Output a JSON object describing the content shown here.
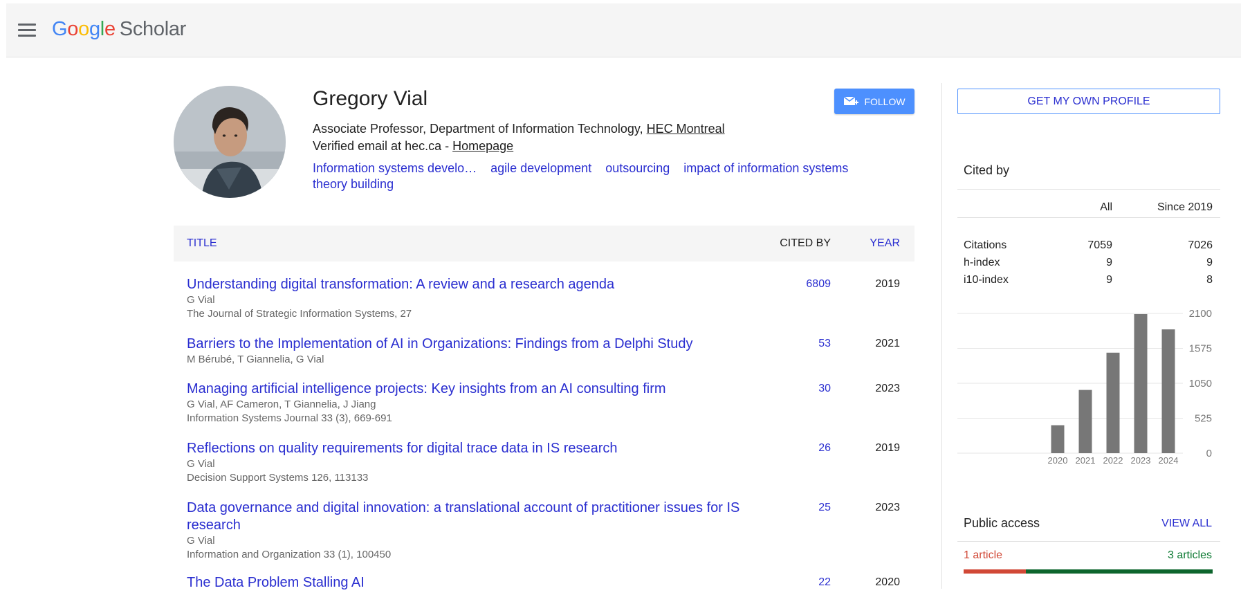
{
  "header": {
    "logo_letters": [
      "G",
      "o",
      "o",
      "g",
      "l",
      "e"
    ],
    "logo_product": "Scholar"
  },
  "profile": {
    "name": "Gregory Vial",
    "follow_label": "FOLLOW",
    "affiliation_prefix": "Associate Professor, Department of Information Technology,",
    "affiliation_link": "HEC Montreal",
    "email_text": "Verified email at hec.ca -",
    "homepage_link": "Homepage",
    "interests": [
      "Information systems develo…",
      "agile development",
      "outsourcing",
      "impact of information systems",
      "theory building"
    ]
  },
  "table": {
    "col_title": "TITLE",
    "col_cited": "CITED BY",
    "col_year": "YEAR",
    "rows": [
      {
        "title": "Understanding digital transformation: A review and a research agenda",
        "authors": "G Vial",
        "venue": "The Journal of Strategic Information Systems, 27",
        "cited": "6809",
        "year": "2019"
      },
      {
        "title": "Barriers to the Implementation of AI in Organizations: Findings from a Delphi Study",
        "authors": "M Bérubé, T Giannelia, G Vial",
        "venue": "",
        "cited": "53",
        "year": "2021"
      },
      {
        "title": "Managing artificial intelligence projects: Key insights from an AI consulting firm",
        "authors": "G Vial, AF Cameron, T Giannelia, J Jiang",
        "venue": "Information Systems Journal 33 (3), 669-691",
        "cited": "30",
        "year": "2023"
      },
      {
        "title": "Reflections on quality requirements for digital trace data in IS research",
        "authors": "G Vial",
        "venue": "Decision Support Systems 126, 113133",
        "cited": "26",
        "year": "2019"
      },
      {
        "title": "Data governance and digital innovation: a translational account of practitioner issues for IS research",
        "authors": "G Vial",
        "venue": "Information and Organization 33 (1), 100450",
        "cited": "25",
        "year": "2023"
      },
      {
        "title": "The Data Problem Stalling AI",
        "authors": "",
        "venue": "",
        "cited": "22",
        "year": "2020"
      }
    ]
  },
  "sidebar": {
    "get_profile_label": "GET MY OWN PROFILE",
    "cited_by_heading": "Cited by",
    "stats_header": [
      "",
      "All",
      "Since 2019"
    ],
    "stats_rows": [
      {
        "label": "Citations",
        "all": "7059",
        "since": "7026"
      },
      {
        "label": "h-index",
        "all": "9",
        "since": "9"
      },
      {
        "label": "i10-index",
        "all": "9",
        "since": "8"
      }
    ],
    "public_access_heading": "Public access",
    "view_all_label": "VIEW ALL",
    "pa_unavailable": "1 article",
    "pa_available": "3 articles",
    "pa_fraction": 0.25,
    "pa_colors": {
      "unavailable": "#d14836",
      "available": "#0d652d"
    }
  },
  "chart_data": {
    "type": "bar",
    "categories": [
      "2020",
      "2021",
      "2022",
      "2023",
      "2024"
    ],
    "values": [
      420,
      950,
      1510,
      2090,
      1860
    ],
    "yticks": [
      0,
      525,
      1050,
      1575,
      2100
    ],
    "ylim": [
      0,
      2100
    ],
    "grid": true,
    "bar_color": "#777777"
  },
  "colors": {
    "link": "#2a2ed0",
    "accent": "#4d90fe"
  }
}
